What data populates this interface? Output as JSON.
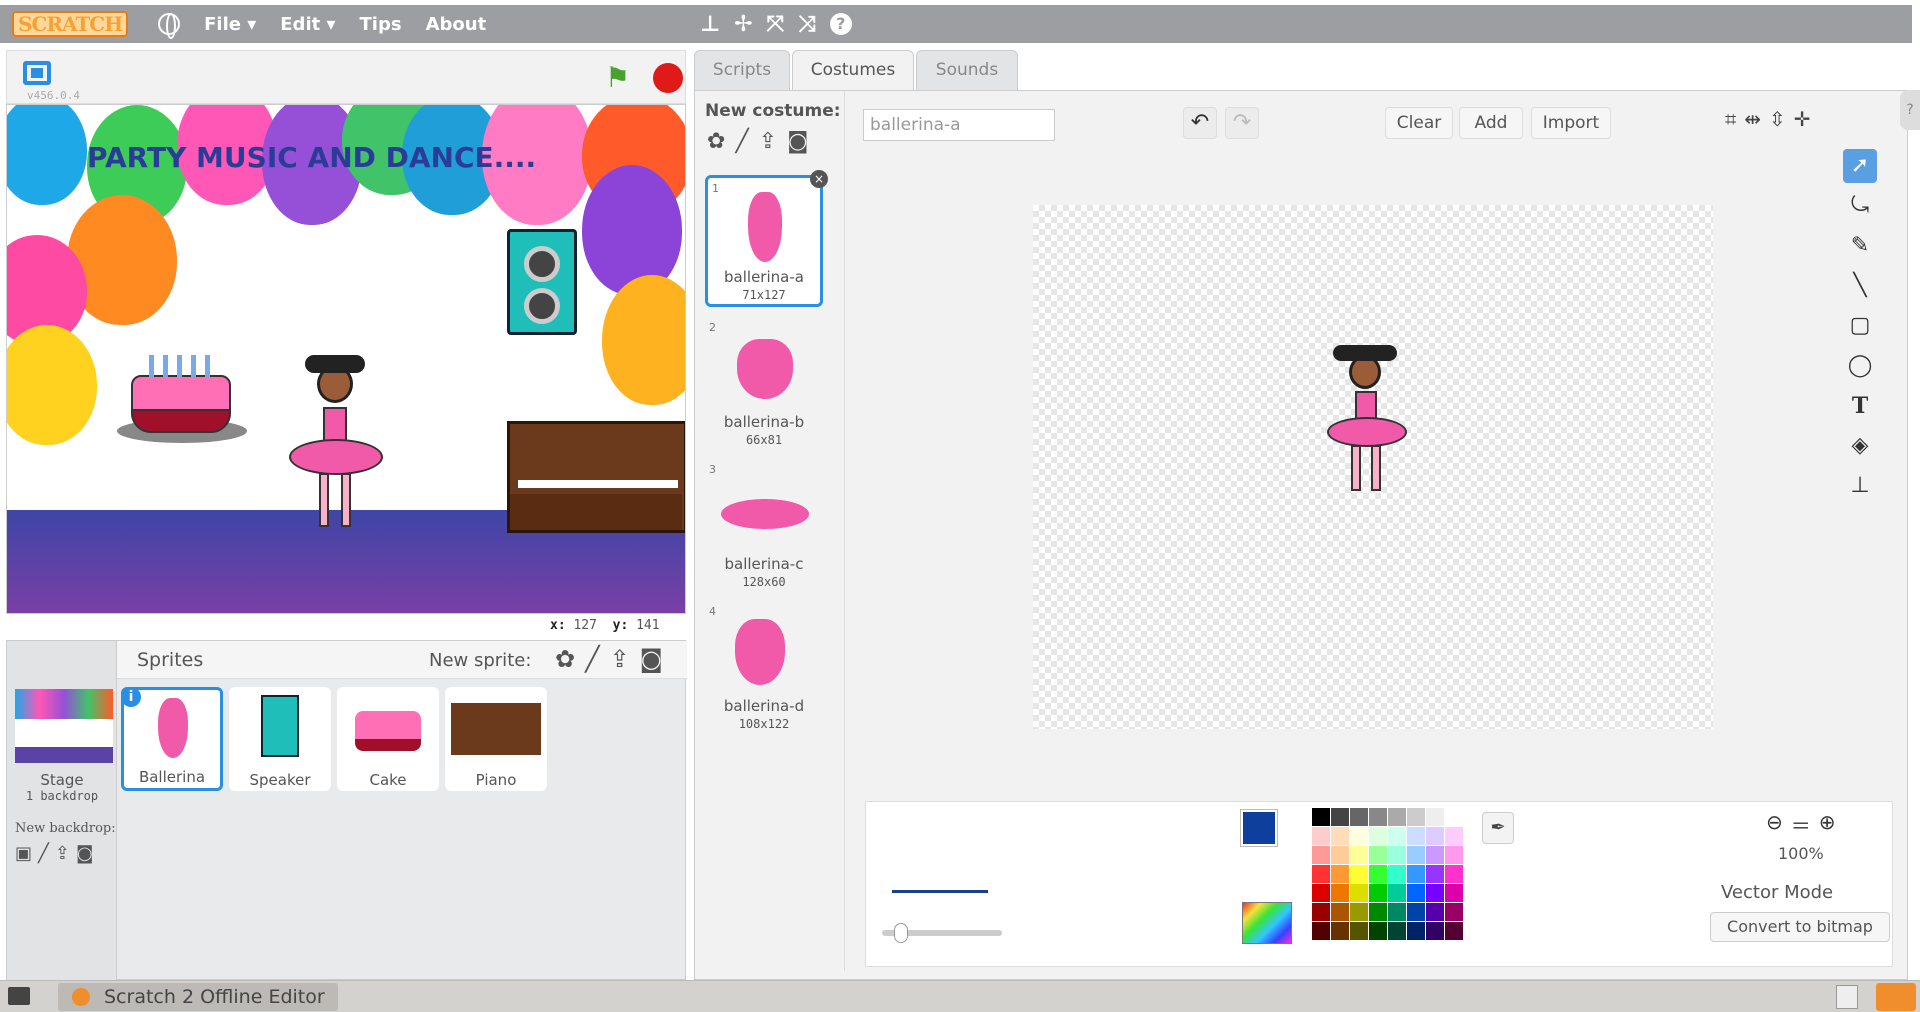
{
  "menu": {
    "logo": "SCRATCH",
    "items": [
      "File ▾",
      "Edit ▾",
      "Tips",
      "About"
    ]
  },
  "toolbar_icons": [
    "duplicate-icon",
    "delete-icon",
    "grow-icon",
    "shrink-icon",
    "help-icon"
  ],
  "stage": {
    "version": "v456.0.4",
    "title": "PARTY MUSIC AND DANCE....",
    "x_label": "x:",
    "x_value": "127",
    "y_label": "y:",
    "y_value": "141"
  },
  "sprites_panel": {
    "title": "Sprites",
    "new_sprite": "New sprite:",
    "stage_label": "Stage",
    "stage_sub": "1 backdrop",
    "new_backdrop": "New backdrop:",
    "sprites": [
      {
        "name": "Ballerina",
        "selected": true
      },
      {
        "name": "Speaker"
      },
      {
        "name": "Cake"
      },
      {
        "name": "Piano"
      }
    ]
  },
  "tabs": [
    "Scripts",
    "Costumes",
    "Sounds"
  ],
  "active_tab": "Costumes",
  "costumes_panel": {
    "new_costume": "New costume:",
    "items": [
      {
        "num": "1",
        "name": "ballerina-a",
        "size": "71x127",
        "selected": true
      },
      {
        "num": "2",
        "name": "ballerina-b",
        "size": "66x81"
      },
      {
        "num": "3",
        "name": "ballerina-c",
        "size": "128x60"
      },
      {
        "num": "4",
        "name": "ballerina-d",
        "size": "108x122"
      }
    ]
  },
  "paint_editor": {
    "costume_name": "ballerina-a",
    "clear": "Clear",
    "add": "Add",
    "import": "Import",
    "zoom": "100%",
    "mode": "Vector Mode",
    "convert": "Convert to bitmap",
    "selected_color": "#0f3f9c",
    "line_width": 0.1
  },
  "taskbar": {
    "window": "Scratch 2 Offline Editor"
  }
}
